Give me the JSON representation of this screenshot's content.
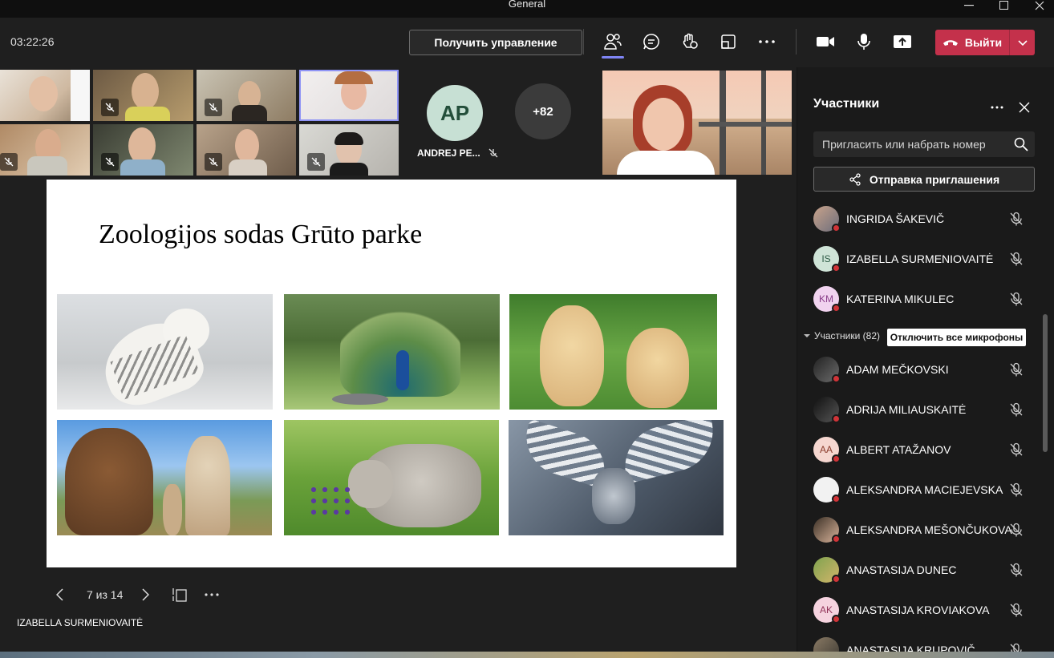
{
  "window": {
    "title": "General"
  },
  "toolbar": {
    "timer": "03:22:26",
    "control_label": "Получить управление",
    "leave_label": "Выйти"
  },
  "gallery": {
    "ap_initials": "AP",
    "ap_name": "ANDREJ PE...",
    "more_count": "+82"
  },
  "slide": {
    "title": "Zoologijos sodas Grūto parke",
    "photos": [
      "snowy owl",
      "peacock",
      "silkie chickens",
      "alpacas",
      "donkey foal",
      "hawk"
    ]
  },
  "slidenav": {
    "counter": "7 из 14"
  },
  "presenter": "IZABELLA SURMENIOVAITĖ",
  "panel": {
    "title": "Участники",
    "invite_placeholder": "Пригласить или набрать номер",
    "share_label": "Отправка приглашения",
    "section_label": "Участники (82)",
    "mute_all_label": "Отключить все микрофоны",
    "organizers": [
      {
        "name": "INGRIDA ŠAKEVIČ",
        "initials": ""
      },
      {
        "name": "IZABELLA SURMENIOVAITĖ",
        "initials": "IS"
      },
      {
        "name": "KATERINA MIKULEC",
        "initials": "KM"
      }
    ],
    "attendees": [
      {
        "name": "ADAM MEČKOVSKI",
        "initials": ""
      },
      {
        "name": "ADRIJA MILIAUSKAITĖ",
        "initials": ""
      },
      {
        "name": "ALBERT ATAŽANOV",
        "initials": "AA"
      },
      {
        "name": "ALEKSANDRA MACIEJEVSKA",
        "initials": ""
      },
      {
        "name": "ALEKSANDRA MEŠONČUKOVA",
        "initials": ""
      },
      {
        "name": "ANASTASIJA DUNEC",
        "initials": ""
      },
      {
        "name": "ANASTASIJA KROVIAKOVA",
        "initials": "AK"
      },
      {
        "name": "ANASTASIJA KRUPOVIČ",
        "initials": ""
      }
    ]
  },
  "colors": {
    "accent": "#7f85f5",
    "leave": "#c4314b",
    "status_dot": "#d13438"
  }
}
